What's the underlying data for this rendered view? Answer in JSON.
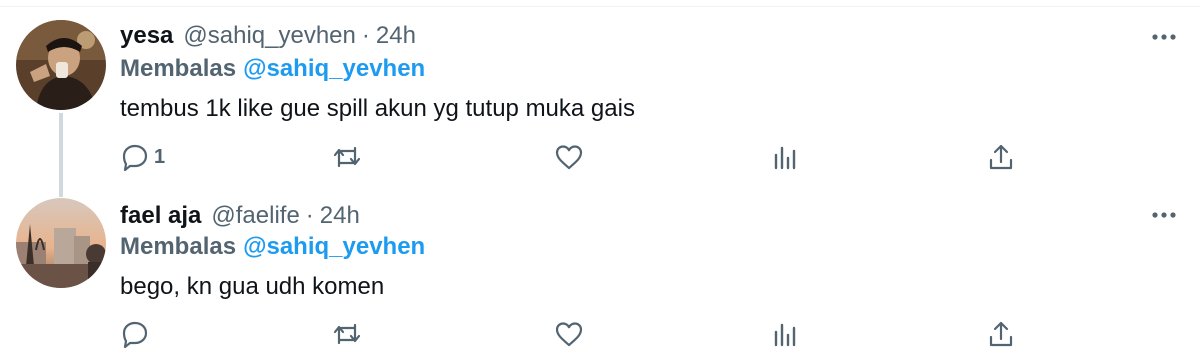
{
  "replies": [
    {
      "name": "yesa",
      "handle": "@sahiq_yevhen",
      "separator": "·",
      "time": "24h",
      "reply_prefix": "Membalas",
      "reply_mention": "@sahiq_yevhen",
      "text": "tembus 1k like gue spill akun yg tutup muka gais",
      "reply_count": "1"
    },
    {
      "name": "fael aja",
      "handle": "@faelife",
      "separator": "·",
      "time": "24h",
      "reply_prefix": "Membalas",
      "reply_mention": "@sahiq_yevhen",
      "text": "bego, kn gua udh komen",
      "reply_count": ""
    }
  ],
  "colors": {
    "accent": "#1d9bf0",
    "secondary_text": "#536471",
    "thread_line": "#cfd9de"
  },
  "icons": [
    "reply-icon",
    "retweet-icon",
    "like-icon",
    "stats-icon",
    "share-icon",
    "more-icon"
  ]
}
